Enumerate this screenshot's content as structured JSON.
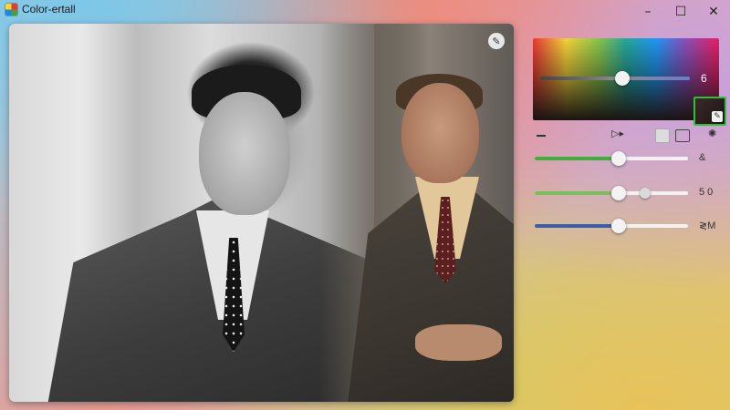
{
  "window": {
    "title": "Color-ertall",
    "controls": {
      "minimize": "–",
      "maximize": "☐",
      "close": "✕"
    }
  },
  "canvas": {
    "badge_icon": "pin-icon",
    "left_photo": "black-and-white portrait",
    "right_photo": "colorized portrait"
  },
  "panel": {
    "picker": {
      "hue_value": "6",
      "hue_level": 0.55,
      "swatch_color": "#2a1d1d",
      "swatch_border_color": "#2fbf3a"
    },
    "toolbar": {
      "minus_icon": "minus-icon",
      "play_label": "▷▸",
      "square_icon": "square-icon",
      "image_icon": "image-icon",
      "gear_icon": "gear-icon"
    },
    "sliders": [
      {
        "value_label": "&",
        "level": 0.55,
        "fill_color": "#3fae3a"
      },
      {
        "value_label": "5 0",
        "level": 0.55,
        "level2": 0.72,
        "fill_color": "#7bbf5a"
      },
      {
        "value_label": "≷M",
        "level": 0.55,
        "fill_color": "#3a5fa8"
      }
    ]
  }
}
